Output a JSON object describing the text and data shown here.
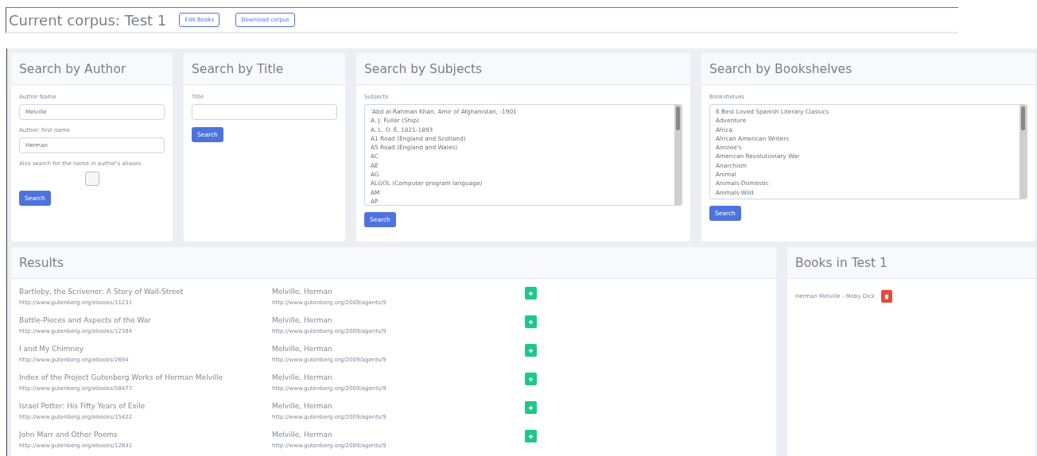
{
  "header": {
    "title": "Current corpus: Test 1",
    "buttons": [
      "Edit Books",
      "Download corpus"
    ]
  },
  "author_search": {
    "title": "Search by Author",
    "fields": [
      {
        "label": "Author Name",
        "value": "Melville"
      },
      {
        "label": "Author: first name",
        "value": "Herman"
      }
    ],
    "alias_label": "Also search for the name in author's aliases",
    "alias_checked": false,
    "button": "Search"
  },
  "title_search": {
    "title": "Search by Title",
    "label": "Title",
    "button": "Search"
  },
  "subject_search": {
    "title": "Search by Subjects",
    "label": "Subjects",
    "options": [
      "'Abd al-Rahman Khan, Amir of Afghanistan, -1901",
      "A. J. Fuller (Ship)",
      "A. L. O. E, 1821-1893",
      "A1 Road (England and Scotland)",
      "A5 Road (England and Wales)",
      "AC",
      "AE",
      "AG",
      "ALGOL (Computer program language)",
      "AM",
      "AP"
    ],
    "button": "Search"
  },
  "bookshelf_search": {
    "title": "Search by Bookshelves",
    "label": "Bookshelves",
    "options": [
      "6 Best Loved Spanish Literary Classics",
      "Adventure",
      "Africa",
      "African American Writers",
      "Ainslee's",
      "American Revolutionary War",
      "Anarchism",
      "Animal",
      "Animals-Domestic",
      "Animals-Wild"
    ],
    "button": "Search"
  },
  "results": {
    "title": "Results",
    "rows": [
      {
        "title": "Bartleby, the Scrivener: A Story of Wall-Street",
        "title_url": "http://www.gutenberg.org/ebooks/11231",
        "author": "Melville, Herman",
        "author_url": "http://www.gutenberg.org/2009/agents/9"
      },
      {
        "title": "Battle-Pieces and Aspects of the War",
        "title_url": "http://www.gutenberg.org/ebooks/12384",
        "author": "Melville, Herman",
        "author_url": "http://www.gutenberg.org/2009/agents/9"
      },
      {
        "title": "I and My Chimney",
        "title_url": "http://www.gutenberg.org/ebooks/2694",
        "author": "Melville, Herman",
        "author_url": "http://www.gutenberg.org/2009/agents/9"
      },
      {
        "title": "Index of the Project Gutenberg Works of Herman Melville",
        "title_url": "http://www.gutenberg.org/ebooks/58477",
        "author": "Melville, Herman",
        "author_url": "http://www.gutenberg.org/2009/agents/9"
      },
      {
        "title": "Israel Potter: His Fifty Years of Exile",
        "title_url": "http://www.gutenberg.org/ebooks/15422",
        "author": "Melville, Herman",
        "author_url": "http://www.gutenberg.org/2009/agents/9"
      },
      {
        "title": "John Marr and Other Poems",
        "title_url": "http://www.gutenberg.org/ebooks/12841",
        "author": "Melville, Herman",
        "author_url": "http://www.gutenberg.org/2009/agents/9"
      }
    ]
  },
  "corpus_books": {
    "title": "Books in Test 1",
    "items": [
      "Herman Melville - Moby Dick"
    ]
  }
}
